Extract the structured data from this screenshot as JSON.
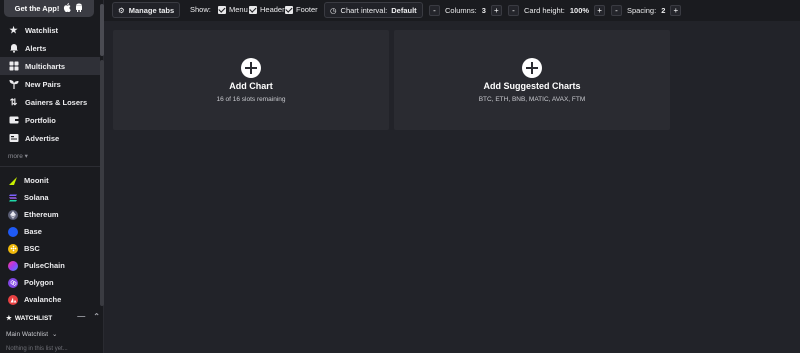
{
  "sidebar": {
    "get_app": "Get the App!",
    "nav": [
      {
        "label": "Watchlist",
        "icon": "star-icon"
      },
      {
        "label": "Alerts",
        "icon": "bell-icon"
      },
      {
        "label": "Multicharts",
        "icon": "grid-icon",
        "active": true
      },
      {
        "label": "New Pairs",
        "icon": "sprout-icon"
      },
      {
        "label": "Gainers & Losers",
        "icon": "arrows-updown-icon"
      },
      {
        "label": "Portfolio",
        "icon": "wallet-icon"
      },
      {
        "label": "Advertise",
        "icon": "megaphone-icon"
      }
    ],
    "more": "more",
    "chains": [
      {
        "label": "Moonit",
        "icon": "moonit-icon",
        "color": "#c8f000"
      },
      {
        "label": "Solana",
        "icon": "solana-icon",
        "color": "#8a5cf5"
      },
      {
        "label": "Ethereum",
        "icon": "ethereum-icon",
        "color": "#8a8fa8"
      },
      {
        "label": "Base",
        "icon": "base-icon",
        "color": "#1f5af5"
      },
      {
        "label": "BSC",
        "icon": "bsc-icon",
        "color": "#f0b90b"
      },
      {
        "label": "PulseChain",
        "icon": "pulsechain-icon",
        "color": "#d13cf0"
      },
      {
        "label": "Polygon",
        "icon": "polygon-icon",
        "color": "#8247e5"
      },
      {
        "label": "Avalanche",
        "icon": "avalanche-icon",
        "color": "#e84142"
      }
    ],
    "watchlist_header": "WATCHLIST",
    "watchlist_select": "Main Watchlist",
    "watchlist_empty": "Nothing in this list yet..."
  },
  "toolbar": {
    "manage_tabs": "Manage tabs",
    "show_label": "Show:",
    "show_menu": "Menu",
    "show_header": "Header",
    "show_footer": "Footer",
    "chart_interval_label": "Chart interval:",
    "chart_interval_value": "Default",
    "columns_label": "Columns:",
    "columns_value": "3",
    "card_height_label": "Card height:",
    "card_height_value": "100%",
    "spacing_label": "Spacing:",
    "spacing_value": "2",
    "minus": "-",
    "plus": "+"
  },
  "cards": [
    {
      "title": "Add Chart",
      "subtitle": "16 of 16 slots remaining"
    },
    {
      "title": "Add Suggested Charts",
      "subtitle": "BTC, ETH, BNB, MATIC, AVAX, FTM"
    }
  ],
  "colors": {
    "background": "#222329",
    "sidebar": "#1a1b1f",
    "card": "#2a2b31",
    "accent": "#ffffff"
  }
}
